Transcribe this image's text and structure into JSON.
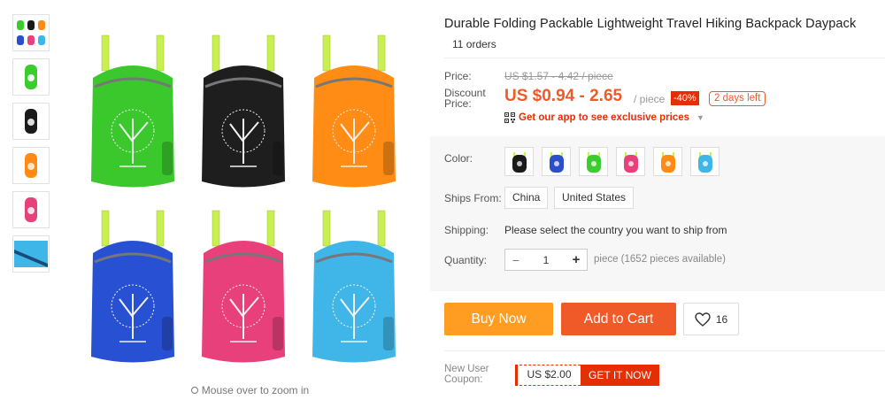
{
  "product": {
    "title": "Durable Folding Packable Lightweight Travel Hiking Backpack Daypack",
    "orders": "11 orders"
  },
  "gallery": {
    "zoom_hint": "Mouse over to zoom in",
    "thumbnails": [
      "multi-color",
      "green",
      "black",
      "orange",
      "pink",
      "blue-strap"
    ]
  },
  "pricing": {
    "price_label": "Price:",
    "original_price": "US $1.57 - 4.42 / piece",
    "discount_label_1": "Discount",
    "discount_label_2": "Price:",
    "discount_price": "US $0.94 - 2.65",
    "unit": "/ piece",
    "discount_badge": "-40%",
    "time_left": "2 days left",
    "app_promo": "Get our app to see exclusive prices"
  },
  "options": {
    "color_label": "Color:",
    "colors": [
      "#1a1a1a",
      "#2a4fc9",
      "#3ccc2f",
      "#e8407a",
      "#ff8a14",
      "#3fb6e8"
    ],
    "ships_from_label": "Ships From:",
    "ships_from": [
      "China",
      "United States"
    ],
    "shipping_label": "Shipping:",
    "shipping_text": "Please select the country you want to ship from",
    "quantity_label": "Quantity:",
    "quantity": "1",
    "availability": "piece (1652 pieces available)"
  },
  "actions": {
    "buy_now": "Buy Now",
    "add_to_cart": "Add to Cart",
    "wishlist_count": "16"
  },
  "coupon": {
    "label_1": "New User",
    "label_2": "Coupon:",
    "amount": "US $2.00",
    "cta": "GET IT NOW"
  },
  "colors": {
    "accent": "#f05a28",
    "buy": "#ff9c22",
    "badge": "#e62e04"
  }
}
